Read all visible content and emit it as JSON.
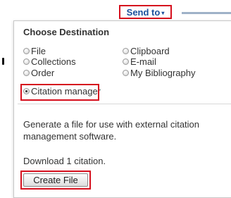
{
  "send_to": {
    "label": "Send to",
    "caret": "▾"
  },
  "panel": {
    "heading": "Choose Destination",
    "options": [
      {
        "label": "File",
        "checked": false
      },
      {
        "label": "Clipboard",
        "checked": false
      },
      {
        "label": "Collections",
        "checked": false
      },
      {
        "label": "E-mail",
        "checked": false
      },
      {
        "label": "Order",
        "checked": false
      },
      {
        "label": "My Bibliography",
        "checked": false
      },
      {
        "label": "Citation manager",
        "checked": true
      }
    ],
    "description": "Generate a file for use with external citation management software.",
    "download_text": "Download 1 citation.",
    "create_button": "Create File"
  },
  "colors": {
    "highlight": "#d6101e",
    "link": "#1a4f9c"
  }
}
